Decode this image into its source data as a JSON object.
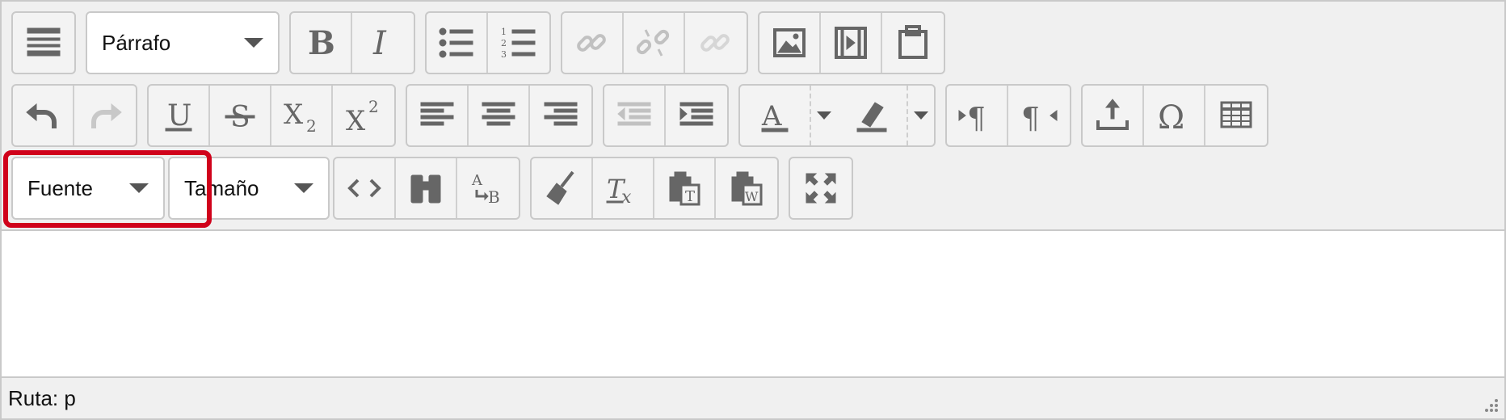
{
  "toolbar": {
    "format_select": {
      "value": "Párrafo"
    },
    "font_select": {
      "value": "Fuente"
    },
    "size_select": {
      "value": "Tamaño"
    },
    "buttons": {
      "toggle": "toolbar-toggle-icon",
      "bold": "bold-icon",
      "italic": "italic-icon",
      "bullet_list": "bullet-list-icon",
      "numbered_list": "numbered-list-icon",
      "link": "link-icon",
      "unlink": "unlink-icon",
      "anchor": "anchor-icon",
      "image": "image-icon",
      "media": "media-icon",
      "paste_text": "paste-icon",
      "undo": "undo-icon",
      "redo": "redo-icon",
      "underline": "underline-icon",
      "strikethrough": "strikethrough-icon",
      "subscript": "subscript-icon",
      "superscript": "superscript-icon",
      "align_left": "align-left-icon",
      "align_center": "align-center-icon",
      "align_right": "align-right-icon",
      "outdent": "outdent-icon",
      "indent": "indent-icon",
      "text_color": "text-color-icon",
      "highlight_color": "highlight-color-icon",
      "ltr": "ltr-icon",
      "rtl": "rtl-icon",
      "upload": "upload-icon",
      "special_char": "omega-icon",
      "table": "table-icon",
      "code": "code-icon",
      "find": "binoculars-icon",
      "replace": "replace-icon",
      "clean": "broom-icon",
      "clear_format": "clear-format-icon",
      "paste_text2": "paste-text-icon",
      "paste_word": "paste-word-icon",
      "fullscreen": "fullscreen-icon"
    }
  },
  "statusbar": {
    "path_label": "Ruta: p"
  },
  "colors": {
    "highlight_border": "#d0021b",
    "icon": "#666666",
    "border": "#c9c9c9"
  }
}
